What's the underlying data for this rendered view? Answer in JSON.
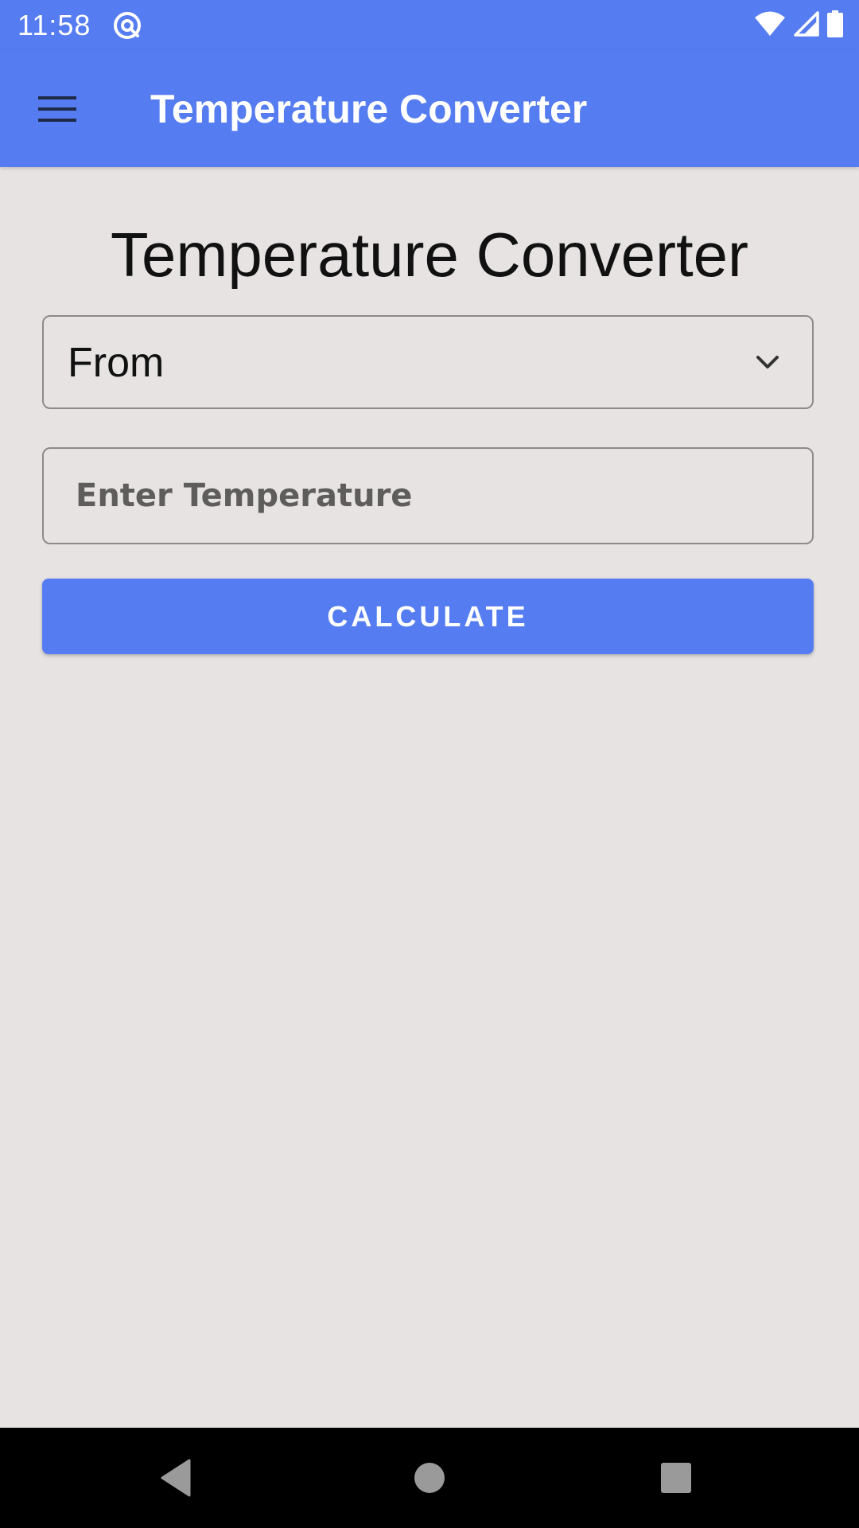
{
  "status_bar": {
    "time": "11:58",
    "icons": [
      "at-sign-icon",
      "wifi-icon",
      "signal-icon",
      "battery-icon"
    ]
  },
  "app_bar": {
    "title": "Temperature Converter",
    "menu_icon": "hamburger-menu-icon"
  },
  "main": {
    "heading": "Temperature Converter",
    "from_select": {
      "label": "From",
      "icon": "chevron-down-icon"
    },
    "temperature_input": {
      "value": "",
      "placeholder": "Enter Temperature"
    },
    "calculate_button": {
      "label": "CALCULATE"
    }
  },
  "nav_bar": {
    "buttons": [
      "back-icon",
      "home-icon",
      "recents-icon"
    ]
  },
  "colors": {
    "primary": "#557cf0",
    "background": "#e7e3e3",
    "border": "#8d8a8a",
    "nav": "#000000"
  }
}
